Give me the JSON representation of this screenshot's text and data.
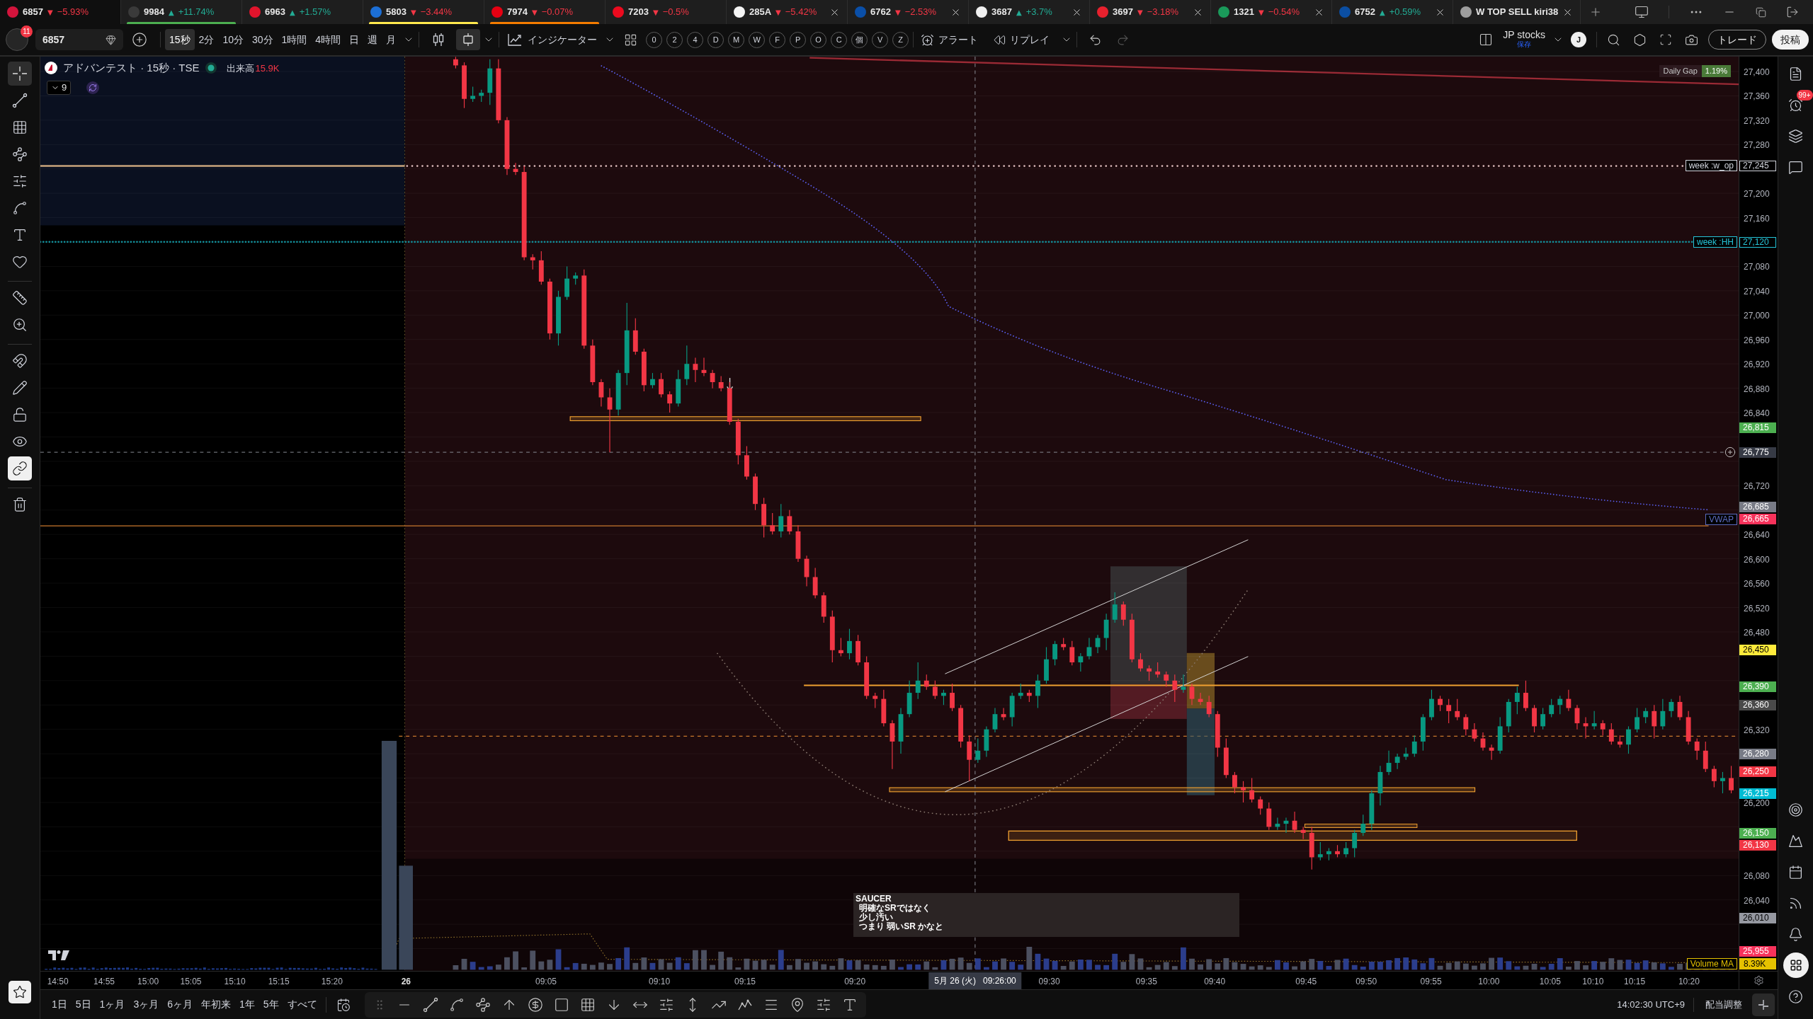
{
  "tabs": [
    {
      "symbol": "6857",
      "arrow": "▼",
      "change": "−5.93%",
      "rising": false,
      "logo": {
        "color": "#d3143c"
      },
      "selected": true,
      "closable": false
    },
    {
      "symbol": "9984",
      "arrow": "▲",
      "change": "+11.74%",
      "rising": true,
      "logo": {
        "color": "#3a3a3a"
      },
      "color": "#4caf50",
      "selected": false,
      "closable": false
    },
    {
      "symbol": "6963",
      "arrow": "▲",
      "change": "+1.57%",
      "rising": true,
      "logo": {
        "color": "#e0142c"
      },
      "selected": false,
      "closable": false
    },
    {
      "symbol": "5803",
      "arrow": "▼",
      "change": "−3.44%",
      "rising": false,
      "logo": {
        "color": "#1c6fd6"
      },
      "color": "#ffe94d",
      "selected": false,
      "closable": false
    },
    {
      "symbol": "7974",
      "arrow": "▼",
      "change": "−0.07%",
      "rising": false,
      "logo": {
        "color": "#e60012"
      },
      "color": "#f57c00",
      "selected": false,
      "closable": false
    },
    {
      "symbol": "7203",
      "arrow": "▼",
      "change": "−0.5%",
      "rising": false,
      "logo": {
        "color": "#eb0a1e"
      },
      "selected": false,
      "closable": false
    },
    {
      "symbol": "285A",
      "arrow": "▼",
      "change": "−5.42%",
      "rising": false,
      "logo": {
        "color": "#f5f5f5"
      },
      "selected": false,
      "closable": true
    },
    {
      "symbol": "6762",
      "arrow": "▼",
      "change": "−2.53%",
      "rising": false,
      "logo": {
        "color": "#0a4fa8"
      },
      "selected": false,
      "closable": true
    },
    {
      "symbol": "3687",
      "arrow": "▲",
      "change": "+3.7%",
      "rising": true,
      "logo": {
        "color": "#f0f0f0"
      },
      "selected": false,
      "closable": true
    },
    {
      "symbol": "3697",
      "arrow": "▼",
      "change": "−3.18%",
      "rising": false,
      "logo": {
        "color": "#e8212e"
      },
      "selected": false,
      "closable": true
    },
    {
      "symbol": "1321",
      "arrow": "▼",
      "change": "−0.54%",
      "rising": false,
      "logo": {
        "color": "#1a9a5a"
      },
      "selected": false,
      "closable": true
    },
    {
      "symbol": "6752",
      "arrow": "▲",
      "change": "+0.59%",
      "rising": true,
      "logo": {
        "color": "#0b4ea2"
      },
      "selected": false,
      "closable": true
    },
    {
      "symbol": "W TOP SELL kiri38",
      "logo": {
        "color": "#9e9e9e"
      },
      "selected": false,
      "closable": true
    }
  ],
  "toolbar": {
    "notifications": "11",
    "symbol": "6857",
    "intervals": [
      {
        "label": "15秒",
        "selected": true
      },
      {
        "label": "2分",
        "selected": false
      },
      {
        "label": "10分",
        "selected": false
      },
      {
        "label": "30分",
        "selected": false
      },
      {
        "label": "1時間",
        "selected": false
      },
      {
        "label": "4時間",
        "selected": false
      },
      {
        "label": "日",
        "selected": false
      },
      {
        "label": "週",
        "selected": false
      },
      {
        "label": "月",
        "selected": false
      }
    ],
    "chart_styles": [
      {
        "kind": "candles",
        "selected": false
      },
      {
        "kind": "hollow",
        "selected": true
      }
    ],
    "indicators": "インジケーター",
    "quick_buttons": [
      "0",
      "2",
      "4",
      "D",
      "M",
      "W",
      "F",
      "P",
      "O",
      "C",
      "個",
      "V",
      "Z"
    ],
    "alert": "アラート",
    "replay": "リプレイ",
    "layout_name": "JP stocks",
    "layout_status": "保存",
    "user_initial": "J",
    "trade": "トレード",
    "publish": "投稿"
  },
  "drawing_tools": [
    [
      {
        "kind": "crosshair",
        "selected": true
      },
      {
        "kind": "trend-line",
        "selected": false
      },
      {
        "kind": "fib-grid",
        "selected": false
      },
      {
        "kind": "pattern",
        "selected": false
      },
      {
        "kind": "price-lines",
        "selected": false
      },
      {
        "kind": "brush",
        "selected": false
      },
      {
        "kind": "text",
        "selected": false
      },
      {
        "kind": "heart",
        "selected": false
      }
    ],
    [
      {
        "kind": "ruler",
        "selected": false
      },
      {
        "kind": "zoom",
        "selected": false
      }
    ],
    [
      {
        "kind": "magnet",
        "on": false
      },
      {
        "kind": "pencil-lock",
        "on": false
      },
      {
        "kind": "lock",
        "on": false
      },
      {
        "kind": "eye",
        "on": false
      },
      {
        "kind": "link",
        "on": true
      }
    ],
    [
      {
        "kind": "trash"
      }
    ]
  ],
  "favorites": {
    "on": true
  },
  "chart": {
    "legend": {
      "title": "アドバンテスト · 15秒 · TSE",
      "volume_label": "出来高",
      "volume_value": "15.9K",
      "hidden_count": "9"
    },
    "daily_gap": {
      "label": "Daily Gap",
      "value": "1.19%"
    },
    "note": [
      "SAUCER",
      "明確なSRではなく",
      "少し汚い",
      "つまり 弱いSR かなと"
    ],
    "volume_ma": {
      "title": "Volume MA",
      "value": "8.39K"
    },
    "chart_data": {
      "type": "candlestick",
      "grid": true,
      "ylim": [
        25923.5,
        27424.4
      ],
      "yticks": [
        {
          "value": 27400,
          "label": "27,400"
        },
        {
          "value": 27360,
          "label": "27,360"
        },
        {
          "value": 27320,
          "label": "27,320"
        },
        {
          "value": 27280,
          "label": "27,280"
        },
        {
          "value": 27200,
          "label": "27,200"
        },
        {
          "value": 27160,
          "label": "27,160"
        },
        {
          "value": 27080,
          "label": "27,080"
        },
        {
          "value": 27040,
          "label": "27,040"
        },
        {
          "value": 27000,
          "label": "27,000"
        },
        {
          "value": 26960,
          "label": "26,960"
        },
        {
          "value": 26920,
          "label": "26,920"
        },
        {
          "value": 26880,
          "label": "26,880"
        },
        {
          "value": 26840,
          "label": "26,840"
        },
        {
          "value": 26720,
          "label": "26,720"
        },
        {
          "value": 26640,
          "label": "26,640"
        },
        {
          "value": 26600,
          "label": "26,600"
        },
        {
          "value": 26560,
          "label": "26,560"
        },
        {
          "value": 26520,
          "label": "26,520"
        },
        {
          "value": 26480,
          "label": "26,480"
        },
        {
          "value": 26320,
          "label": "26,320"
        },
        {
          "value": 26200,
          "label": "26,200"
        },
        {
          "value": 26080,
          "label": "26,080"
        },
        {
          "value": 26040,
          "label": "26,040"
        }
      ],
      "series": [
        {
          "ohlc": [
            [
              27420,
              27424,
              27405,
              27410
            ],
            [
              27410,
              27415,
              27340,
              27355
            ],
            [
              27355,
              27375,
              27350,
              27360
            ],
            [
              27360,
              27370,
              27350,
              27365
            ],
            [
              27365,
              27420,
              27345,
              27405
            ],
            [
              27405,
              27420,
              27315,
              27320
            ],
            [
              27320,
              27325,
              27230,
              27240
            ],
            [
              27240,
              27250,
              27230,
              27235
            ],
            [
              27235,
              27245,
              27090,
              27095
            ],
            [
              27095,
              27100,
              27075,
              27090
            ],
            [
              27090,
              27105,
              27050,
              27055
            ],
            [
              27055,
              27060,
              26960,
              26970
            ],
            [
              26970,
              27040,
              26950,
              27030
            ],
            [
              27030,
              27080,
              27025,
              27060
            ],
            [
              27060,
              27070,
              27050,
              27065
            ],
            [
              27065,
              27075,
              26945,
              26950
            ],
            [
              26950,
              26960,
              26885,
              26890
            ],
            [
              26890,
              26895,
              26850,
              26865
            ],
            [
              26865,
              26880,
              26775,
              26845
            ],
            [
              26845,
              26910,
              26835,
              26905
            ],
            [
              26905,
              27020,
              26885,
              26975
            ],
            [
              26975,
              26995,
              26935,
              26940
            ],
            [
              26940,
              26945,
              26875,
              26885
            ],
            [
              26885,
              26905,
              26880,
              26895
            ],
            [
              26895,
              26905,
              26865,
              26870
            ],
            [
              26870,
              26875,
              26840,
              26855
            ],
            [
              26855,
              26910,
              26850,
              26895
            ],
            [
              26895,
              26950,
              26885,
              26920
            ],
            [
              26920,
              26930,
              26890,
              26910
            ],
            [
              26910,
              26930,
              26900,
              26905
            ],
            [
              26905,
              26910,
              26880,
              26890
            ],
            [
              26890,
              26900,
              26875,
              26880
            ],
            [
              26880,
              26890,
              26820,
              26825
            ],
            [
              26825,
              26830,
              26755,
              26770
            ],
            [
              26770,
              26785,
              26730,
              26735
            ],
            [
              26735,
              26740,
              26680,
              26690
            ],
            [
              26690,
              26700,
              26635,
              26655
            ],
            [
              26655,
              26675,
              26640,
              26645
            ],
            [
              26645,
              26690,
              26635,
              26670
            ],
            [
              26670,
              26680,
              26640,
              26645
            ],
            [
              26645,
              26655,
              26595,
              26600
            ],
            [
              26600,
              26605,
              26555,
              26570
            ],
            [
              26570,
              26585,
              26535,
              26540
            ],
            [
              26540,
              26545,
              26495,
              26505
            ],
            [
              26505,
              26515,
              26430,
              26450
            ],
            [
              26450,
              26470,
              26440,
              26445
            ],
            [
              26445,
              26485,
              26435,
              26465
            ],
            [
              26465,
              26475,
              26425,
              26430
            ],
            [
              26430,
              26440,
              26370,
              26375
            ],
            [
              26375,
              26380,
              26355,
              26370
            ],
            [
              26370,
              26385,
              26325,
              26330
            ],
            [
              26330,
              26335,
              26255,
              26300
            ],
            [
              26300,
              26355,
              26280,
              26345
            ],
            [
              26345,
              26400,
              26340,
              26380
            ],
            [
              26380,
              26430,
              26370,
              26400
            ],
            [
              26400,
              26410,
              26385,
              26390
            ],
            [
              26390,
              26400,
              26370,
              26375
            ],
            [
              26375,
              26385,
              26360,
              26380
            ],
            [
              26380,
              26395,
              26350,
              26355
            ],
            [
              26355,
              26360,
              26290,
              26300
            ],
            [
              26300,
              26310,
              26235,
              26270
            ],
            [
              26270,
              26305,
              26265,
              26285
            ],
            [
              26285,
              26325,
              26275,
              26320
            ],
            [
              26320,
              26355,
              26315,
              26345
            ],
            [
              26345,
              26355,
              26335,
              26340
            ],
            [
              26340,
              26380,
              26325,
              26375
            ],
            [
              26375,
              26395,
              26370,
              26380
            ],
            [
              26380,
              26385,
              26365,
              26375
            ],
            [
              26375,
              26410,
              26355,
              26400
            ],
            [
              26400,
              26455,
              26395,
              26435
            ],
            [
              26435,
              26465,
              26425,
              26460
            ],
            [
              26460,
              26470,
              26450,
              26455
            ],
            [
              26455,
              26465,
              26425,
              26430
            ],
            [
              26430,
              26445,
              26415,
              26440
            ],
            [
              26440,
              26470,
              26435,
              26455
            ],
            [
              26455,
              26475,
              26445,
              26470
            ],
            [
              26470,
              26510,
              26450,
              26500
            ],
            [
              26500,
              26545,
              26495,
              26525
            ],
            [
              26525,
              26530,
              26490,
              26500
            ],
            [
              26500,
              26510,
              26430,
              26435
            ],
            [
              26435,
              26445,
              26415,
              26420
            ],
            [
              26420,
              26425,
              26400,
              26415
            ],
            [
              26415,
              26430,
              26405,
              26410
            ],
            [
              26410,
              26415,
              26390,
              26400
            ],
            [
              26400,
              26410,
              26365,
              26385
            ],
            [
              26385,
              26410,
              26380,
              26390
            ],
            [
              26390,
              26395,
              26360,
              26370
            ],
            [
              26370,
              26380,
              26360,
              26365
            ],
            [
              26365,
              26375,
              26340,
              26345
            ],
            [
              26345,
              26350,
              26275,
              26290
            ],
            [
              26290,
              26305,
              26240,
              26245
            ],
            [
              26245,
              26250,
              26215,
              26225
            ],
            [
              26225,
              26235,
              26200,
              26220
            ],
            [
              26220,
              26240,
              26200,
              26205
            ],
            [
              26205,
              26210,
              26180,
              26190
            ],
            [
              26190,
              26200,
              26155,
              26160
            ],
            [
              26160,
              26175,
              26155,
              26165
            ],
            [
              26165,
              26175,
              26150,
              26170
            ],
            [
              26170,
              26185,
              26150,
              26155
            ],
            [
              26155,
              26160,
              26140,
              26150
            ],
            [
              26150,
              26160,
              26090,
              26110
            ],
            [
              26110,
              26135,
              26105,
              26115
            ],
            [
              26115,
              26125,
              26105,
              26120
            ],
            [
              26120,
              26130,
              26110,
              26115
            ],
            [
              26115,
              26135,
              26110,
              26125
            ],
            [
              26125,
              26155,
              26110,
              26150
            ],
            [
              26150,
              26180,
              26145,
              26165
            ],
            [
              26165,
              26220,
              26155,
              26215
            ],
            [
              26215,
              26260,
              26195,
              26250
            ],
            [
              26250,
              26285,
              26245,
              26265
            ],
            [
              26265,
              26280,
              26255,
              26275
            ],
            [
              26275,
              26290,
              26270,
              26280
            ],
            [
              26280,
              26310,
              26275,
              26300
            ],
            [
              26300,
              26345,
              26285,
              26340
            ],
            [
              26340,
              26385,
              26335,
              26370
            ],
            [
              26370,
              26375,
              26350,
              26360
            ],
            [
              26360,
              26370,
              26330,
              26350
            ],
            [
              26350,
              26370,
              26335,
              26340
            ],
            [
              26340,
              26345,
              26310,
              26320
            ],
            [
              26320,
              26330,
              26300,
              26305
            ],
            [
              26305,
              26315,
              26285,
              26290
            ],
            [
              26290,
              26295,
              26270,
              26285
            ],
            [
              26285,
              26340,
              26280,
              26325
            ],
            [
              26325,
              26370,
              26315,
              26365
            ],
            [
              26365,
              26390,
              26345,
              26380
            ],
            [
              26380,
              26400,
              26350,
              26355
            ],
            [
              26355,
              26360,
              26315,
              26325
            ],
            [
              26325,
              26355,
              26320,
              26345
            ],
            [
              26345,
              26370,
              26340,
              26360
            ],
            [
              26360,
              26375,
              26345,
              26370
            ],
            [
              26370,
              26385,
              26350,
              26355
            ],
            [
              26355,
              26360,
              26320,
              26330
            ],
            [
              26330,
              26340,
              26305,
              26325
            ],
            [
              26325,
              26350,
              26320,
              26330
            ],
            [
              26330,
              26335,
              26310,
              26320
            ],
            [
              26320,
              26330,
              26295,
              26300
            ],
            [
              26300,
              26310,
              26290,
              26295
            ],
            [
              26295,
              26325,
              26280,
              26320
            ],
            [
              26320,
              26355,
              26315,
              26340
            ],
            [
              26340,
              26355,
              26330,
              26350
            ],
            [
              26350,
              26360,
              26305,
              26325
            ],
            [
              26325,
              26370,
              26320,
              26350
            ],
            [
              26350,
              26370,
              26340,
              26365
            ],
            [
              26365,
              26375,
              26335,
              26340
            ],
            [
              26340,
              26350,
              26295,
              26300
            ],
            [
              26300,
              26305,
              26270,
              26285
            ],
            [
              26285,
              26300,
              26250,
              26255
            ],
            [
              26255,
              26260,
              26225,
              26235
            ],
            [
              26235,
              26250,
              26215,
              26240
            ],
            [
              26240,
              26260,
              26215,
              26220
            ]
          ]
        }
      ]
    }
  },
  "price_scale": {
    "markers": [
      {
        "label": "27,245",
        "kind": "outlined",
        "color": "#d1d4dc",
        "title": {
          "text": "week :w_op",
          "color": "#d1d4dc"
        }
      },
      {
        "label": "27,120",
        "kind": "outlined",
        "color": "#26c6da",
        "title": {
          "text": "week :HH",
          "color": "#26c6da"
        }
      },
      {
        "label": "26,815",
        "kind": "filled",
        "color": "#4caf50"
      },
      {
        "label": "26,775",
        "kind": "crosshair"
      },
      {
        "label": "26,685",
        "kind": "filled",
        "color": "#787b86"
      },
      {
        "label": "26,665",
        "kind": "filled",
        "color": "#f7325b",
        "title": {
          "text": "VWAP",
          "color": "#5c6bc0"
        }
      },
      {
        "label": "26,450",
        "kind": "filled",
        "color": "#ffeb3b"
      },
      {
        "label": "26,390",
        "kind": "filled",
        "color": "#4caf50"
      },
      {
        "label": "26,360",
        "kind": "filled",
        "color": "#4a4a4a"
      },
      {
        "label": "26,280",
        "kind": "filled",
        "color": "#787b86"
      },
      {
        "label": "26,250",
        "kind": "filled",
        "color": "#f23645"
      },
      {
        "label": "26,215",
        "kind": "filled",
        "color": "#00bcd4"
      },
      {
        "label": "26,150",
        "kind": "filled",
        "color": "#4caf50"
      },
      {
        "label": "26,130",
        "kind": "filled",
        "color": "#f23645"
      },
      {
        "label": "26,010",
        "kind": "filled",
        "color": "#9598a1"
      },
      {
        "label": "25,955",
        "kind": "filled",
        "color": "#f7325b"
      }
    ]
  },
  "time_scale": {
    "labels": [
      {
        "text": "14:50",
        "kind": "time"
      },
      {
        "text": "14:55",
        "kind": "time"
      },
      {
        "text": "15:00",
        "kind": "time"
      },
      {
        "text": "15:05",
        "kind": "time"
      },
      {
        "text": "15:10",
        "kind": "time"
      },
      {
        "text": "15:15",
        "kind": "time"
      },
      {
        "text": "15:20",
        "kind": "time"
      },
      {
        "text": "26",
        "kind": "day"
      },
      {
        "text": "09:05",
        "kind": "time"
      },
      {
        "text": "09:10",
        "kind": "time"
      },
      {
        "text": "09:15",
        "kind": "time"
      },
      {
        "text": "09:20",
        "kind": "time"
      },
      {
        "text": "09:30",
        "kind": "time"
      },
      {
        "text": "09:35",
        "kind": "time"
      },
      {
        "text": "09:40",
        "kind": "time"
      },
      {
        "text": "09:45",
        "kind": "time"
      },
      {
        "text": "09:50",
        "kind": "time"
      },
      {
        "text": "09:55",
        "kind": "time"
      },
      {
        "text": "10:00",
        "kind": "time"
      },
      {
        "text": "10:05",
        "kind": "time"
      },
      {
        "text": "10:10",
        "kind": "time"
      },
      {
        "text": "10:15",
        "kind": "time"
      },
      {
        "text": "10:20",
        "kind": "time"
      }
    ],
    "cursor": {
      "date": "5月 26 (火)",
      "time": "09:26:00"
    }
  },
  "bottom_bar": {
    "ranges": [
      "1日",
      "5日",
      "1ヶ月",
      "3ヶ月",
      "6ヶ月",
      "年初来",
      "1年",
      "5年",
      "すべて"
    ],
    "clock": "14:02:30 UTC+9",
    "adjustment": "配当調整"
  },
  "right_sidebar": {
    "top": [
      {
        "kind": "notes",
        "selected": false
      },
      {
        "kind": "alerts",
        "selected": false,
        "badge": "99+"
      },
      {
        "kind": "layers",
        "selected": false
      },
      {
        "kind": "chat",
        "selected": false
      }
    ],
    "bottom": [
      {
        "kind": "target",
        "selected": false
      },
      {
        "kind": "peaks",
        "selected": false
      },
      {
        "kind": "calendar",
        "selected": false
      },
      {
        "kind": "feed",
        "selected": false
      },
      {
        "kind": "bell",
        "selected": false
      },
      {
        "kind": "apps",
        "selected": true
      },
      {
        "kind": "help",
        "selected": false
      }
    ]
  }
}
